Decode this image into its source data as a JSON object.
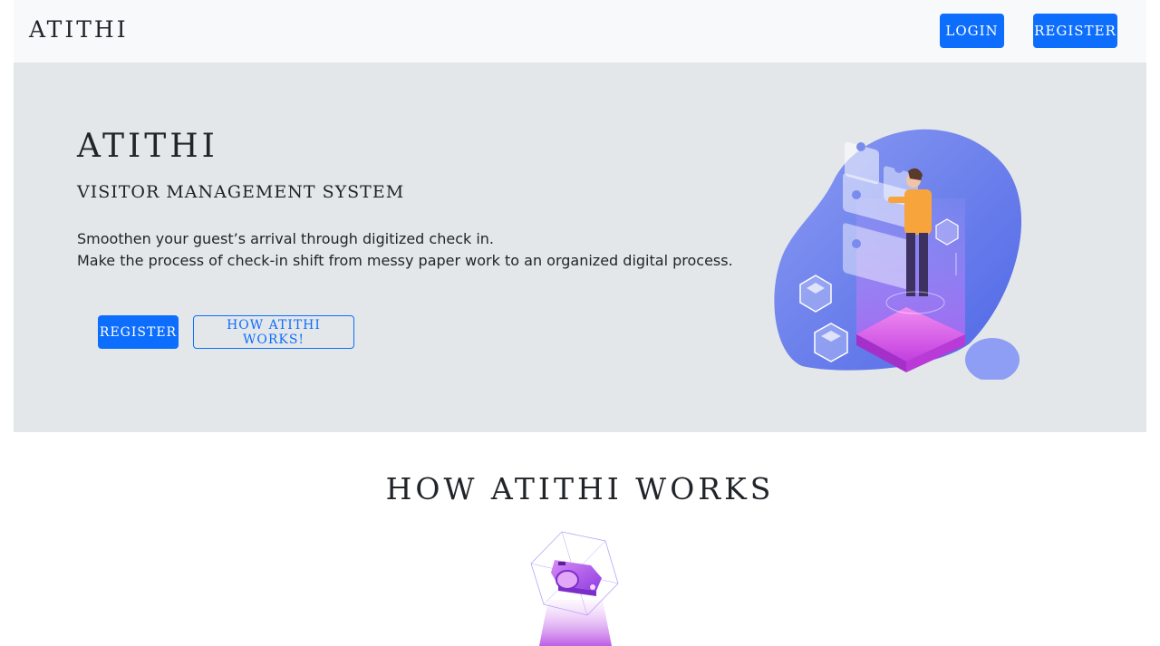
{
  "navbar": {
    "brand": "ATITHI",
    "login_label": "LOGIN",
    "register_label": "REGISTER"
  },
  "hero": {
    "title": "ATITHI",
    "subtitle": "VISITOR MANAGEMENT SYSTEM",
    "line1": "Smoothen your guest’s arrival through digitized check in.",
    "line2": "Make the process of check-in shift from messy paper work to an organized digital process.",
    "register_label": "REGISTER",
    "how_label": "HOW ATITHI WORKS!"
  },
  "section": {
    "title": "HOW ATITHI WORKS"
  },
  "colors": {
    "primary": "#0d6efd",
    "navbar_bg": "#f8f9fa",
    "hero_bg": "#e4e7ea"
  }
}
